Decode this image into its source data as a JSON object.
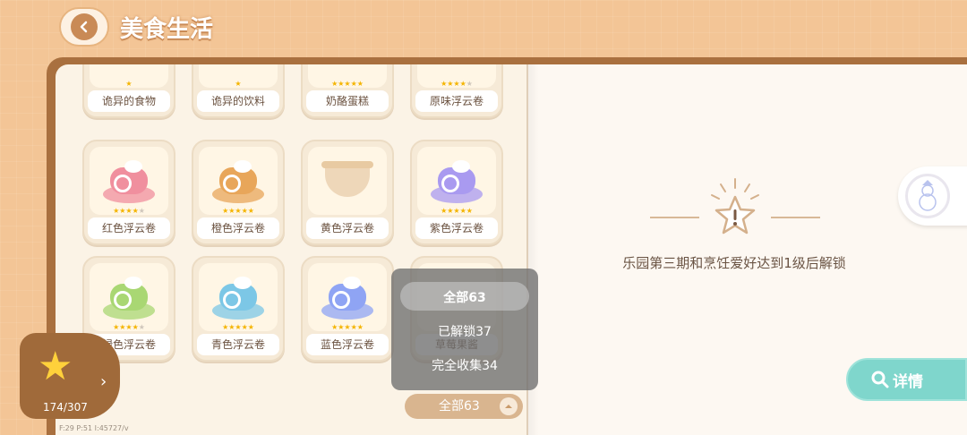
{
  "header": {
    "title": "美食生活",
    "back_icon": "back-arrow-icon"
  },
  "items": [
    {
      "name": "诡异的食物",
      "stars": 1,
      "max_stars": 1,
      "partial": true
    },
    {
      "name": "诡异的饮料",
      "stars": 1,
      "max_stars": 1,
      "partial": true
    },
    {
      "name": "奶酪蛋糕",
      "stars": 5,
      "max_stars": 5,
      "partial": true
    },
    {
      "name": "原味浮云卷",
      "stars": 4,
      "max_stars": 5,
      "partial": true
    },
    {
      "name": "红色浮云卷",
      "stars": 4,
      "max_stars": 5,
      "color": "#f08f9e"
    },
    {
      "name": "橙色浮云卷",
      "stars": 5,
      "max_stars": 5,
      "color": "#e8a65a"
    },
    {
      "name": "黄色浮云卷",
      "stars": 0,
      "max_stars": 0,
      "locked": true
    },
    {
      "name": "紫色浮云卷",
      "stars": 5,
      "max_stars": 5,
      "color": "#a99af0"
    },
    {
      "name": "绿色浮云卷",
      "stars": 4,
      "max_stars": 5,
      "color": "#a9d773"
    },
    {
      "name": "青色浮云卷",
      "stars": 5,
      "max_stars": 5,
      "color": "#7cc7e6"
    },
    {
      "name": "蓝色浮云卷",
      "stars": 5,
      "max_stars": 5,
      "color": "#8fa4f4"
    },
    {
      "name": "草莓果酱",
      "stars": 0,
      "max_stars": 0
    }
  ],
  "detail_panel": {
    "lock_message": "乐园第三期和烹饪爱好达到1级后解锁"
  },
  "detail_button": {
    "label": "详情"
  },
  "filter_menu": {
    "options": [
      "全部63",
      "已解锁37",
      "完全收集34"
    ],
    "selected": "全部63"
  },
  "filter_pill": {
    "label": "全部63"
  },
  "progress": {
    "collected": "174/307"
  },
  "debug_text": "F:29  P:51  I:45727/v",
  "colors": {
    "accent": "#7fd6cc",
    "bg": "#f3c596",
    "book": "#a9703f",
    "star": "#f4b400"
  }
}
